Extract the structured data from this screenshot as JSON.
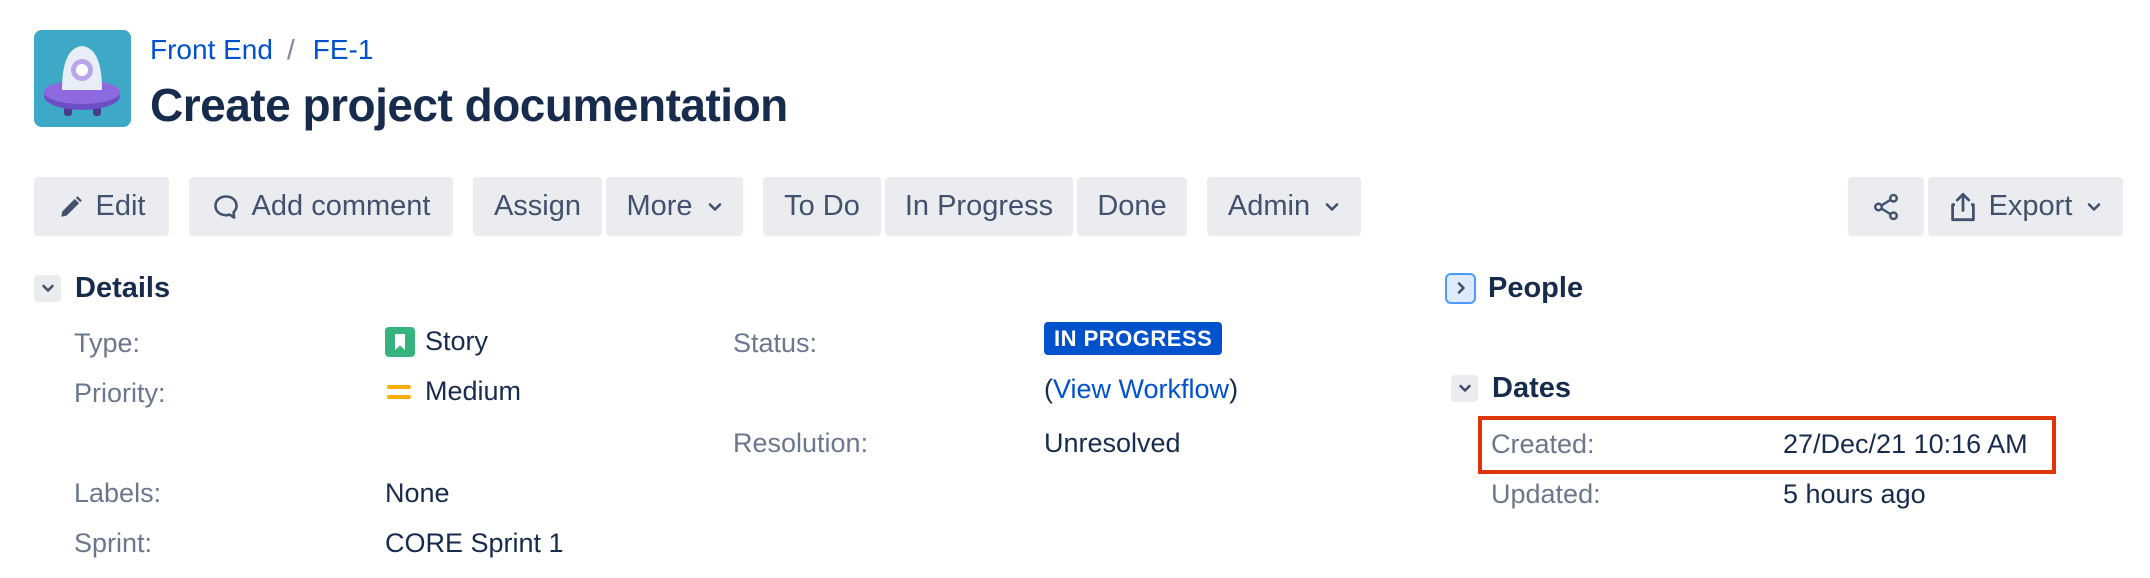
{
  "breadcrumb": {
    "project": "Front End",
    "separator": "/",
    "issue_key": "FE-1"
  },
  "issue": {
    "title": "Create project documentation"
  },
  "toolbar": {
    "edit": "Edit",
    "add_comment": "Add comment",
    "assign": "Assign",
    "more": "More",
    "to_do": "To Do",
    "in_progress": "In Progress",
    "done": "Done",
    "admin": "Admin",
    "export": "Export",
    "icons": {
      "edit": "pencil-icon",
      "comment": "comment-icon",
      "share": "share-icon",
      "export": "export-icon",
      "dropdown": "chevron-down-icon"
    }
  },
  "details": {
    "heading": "Details",
    "type_label": "Type:",
    "type_value": "Story",
    "priority_label": "Priority:",
    "priority_value": "Medium",
    "labels_label": "Labels:",
    "labels_value": "None",
    "sprint_label": "Sprint:",
    "sprint_value": "CORE Sprint 1",
    "status_label": "Status:",
    "status_value": "IN PROGRESS",
    "workflow_open": "(",
    "workflow_link": "View Workflow",
    "workflow_close": ")",
    "resolution_label": "Resolution:",
    "resolution_value": "Unresolved"
  },
  "people": {
    "heading": "People"
  },
  "dates": {
    "heading": "Dates",
    "created_label": "Created:",
    "created_value": "27/Dec/21 10:16 AM",
    "updated_label": "Updated:",
    "updated_value": "5 hours ago"
  },
  "colors": {
    "link": "#0052cc",
    "button_bg": "#ebecf0",
    "status_lozenge": "#0052cc",
    "story_icon": "#36b37e",
    "priority_medium": "#ffab00",
    "highlight": "#de350b"
  }
}
